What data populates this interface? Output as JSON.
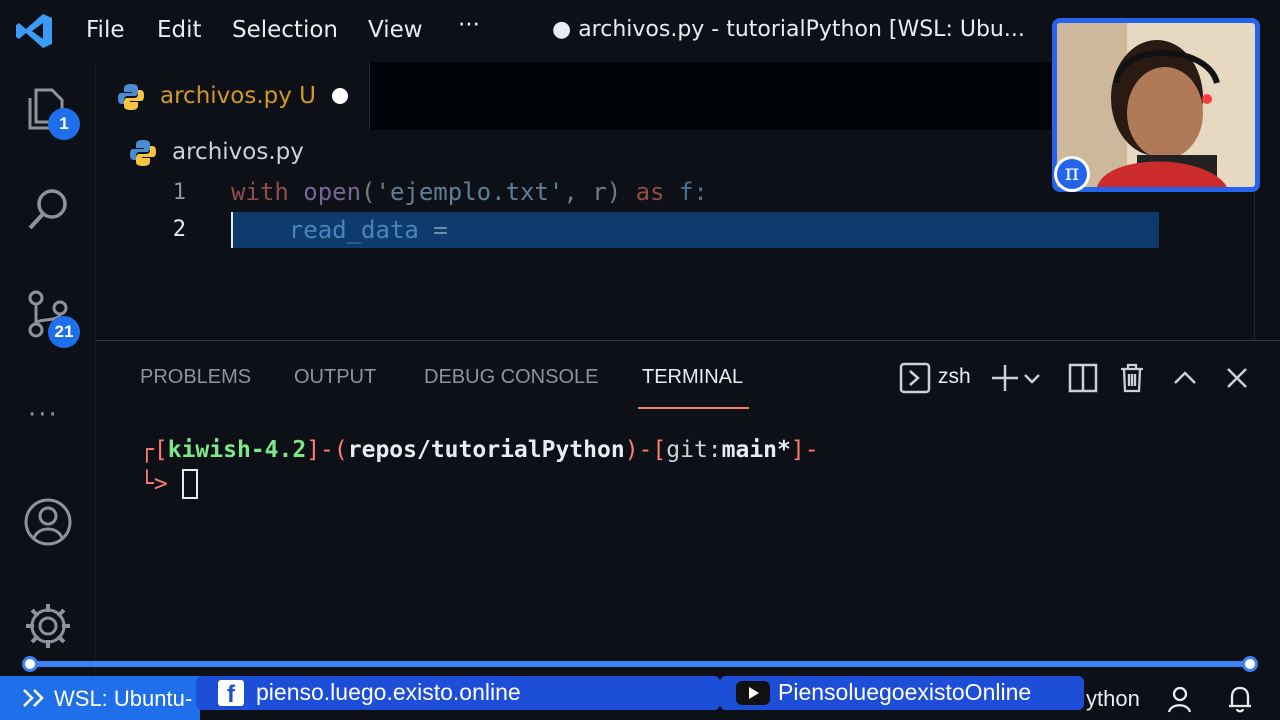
{
  "menu": {
    "file": "File",
    "edit": "Edit",
    "selection": "Selection",
    "view": "View",
    "more": "···"
  },
  "window_title": "● archivos.py - tutorialPython [WSL: Ubu...",
  "activity": {
    "explorer_badge": "1",
    "source_control_badge": "21",
    "more": "···"
  },
  "tab": {
    "label": "archivos.py",
    "status": "U"
  },
  "breadcrumb": {
    "file": "archivos.py"
  },
  "editor": {
    "line_numbers": [
      "1",
      "2"
    ],
    "line1": {
      "kw_with": "with",
      "fn_open": "open",
      "paren_open": "(",
      "str": "'ejemplo.txt'",
      "rest": ", r) ",
      "kw_as": "as",
      "var_f": " f:"
    },
    "line2": {
      "indent": "    ",
      "var": "read_data",
      "op": " ="
    }
  },
  "panel": {
    "tabs": [
      "PROBLEMS",
      "OUTPUT",
      "DEBUG CONSOLE",
      "TERMINAL"
    ],
    "active_tab": "TERMINAL",
    "shell": "zsh"
  },
  "terminal": {
    "corner_top": "┌",
    "open1": "[",
    "host": "kiwish-4.2",
    "close1": "]-(",
    "path": "repos/tutorialPython",
    "close2": ")-[",
    "git_label": "git:",
    "branch": "main*",
    "close3": "]-",
    "corner_bottom": "└>"
  },
  "status": {
    "remote": "WSL: Ubuntu-",
    "language": "ython"
  },
  "social": {
    "facebook": "pienso.luego.existo.online",
    "youtube": "PiensoluegoexistoOnline"
  },
  "webcam": {
    "badge": "π"
  },
  "progress": {
    "played_fraction": 1.0
  },
  "colors": {
    "accent": "#1f6feb",
    "background": "#0d1117",
    "selection": "#0e3a6e",
    "modified_tab": "#d29922"
  }
}
